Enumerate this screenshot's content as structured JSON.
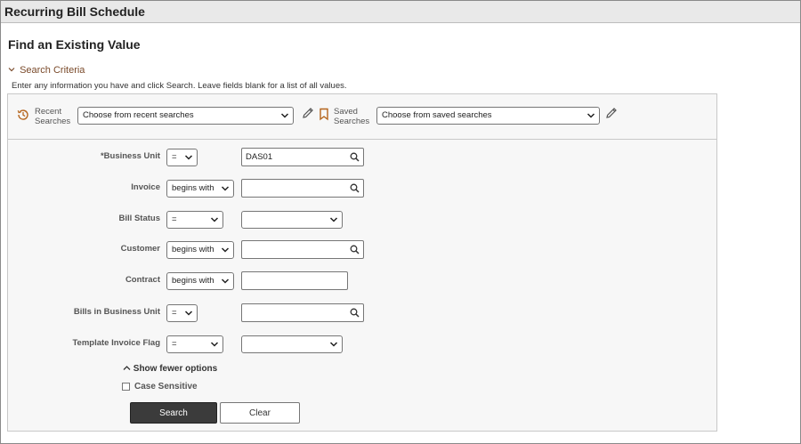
{
  "window": {
    "title": "Recurring Bill Schedule"
  },
  "page": {
    "heading": "Find an Existing Value",
    "section_toggle": "Search Criteria",
    "instructions": "Enter any information you have and click Search. Leave fields blank for a list of all values."
  },
  "saved_searches": {
    "recent_label_line1": "Recent",
    "recent_label_line2": "Searches",
    "recent_select": "Choose from recent searches",
    "saved_label_line1": "Saved",
    "saved_label_line2": "Searches",
    "saved_select": "Choose from saved searches"
  },
  "criteria": [
    {
      "label": "*Business Unit",
      "operator": "=",
      "value": "DAS01"
    },
    {
      "label": "Invoice",
      "operator": "begins with",
      "value": ""
    },
    {
      "label": "Bill Status",
      "operator": "=",
      "value": ""
    },
    {
      "label": "Customer",
      "operator": "begins with",
      "value": ""
    },
    {
      "label": "Contract",
      "operator": "begins with",
      "value": ""
    },
    {
      "label": "Bills in Business Unit",
      "operator": "=",
      "value": ""
    },
    {
      "label": "Template Invoice Flag",
      "operator": "=",
      "value": ""
    }
  ],
  "options": {
    "show_fewer": "Show fewer options",
    "case_sensitive": "Case Sensitive",
    "case_sensitive_checked": false
  },
  "buttons": {
    "search": "Search",
    "clear": "Clear"
  },
  "colors": {
    "accent": "#7a4a2a",
    "primary_button": "#3b3b3b",
    "title_bar": "#e9e9e9"
  }
}
